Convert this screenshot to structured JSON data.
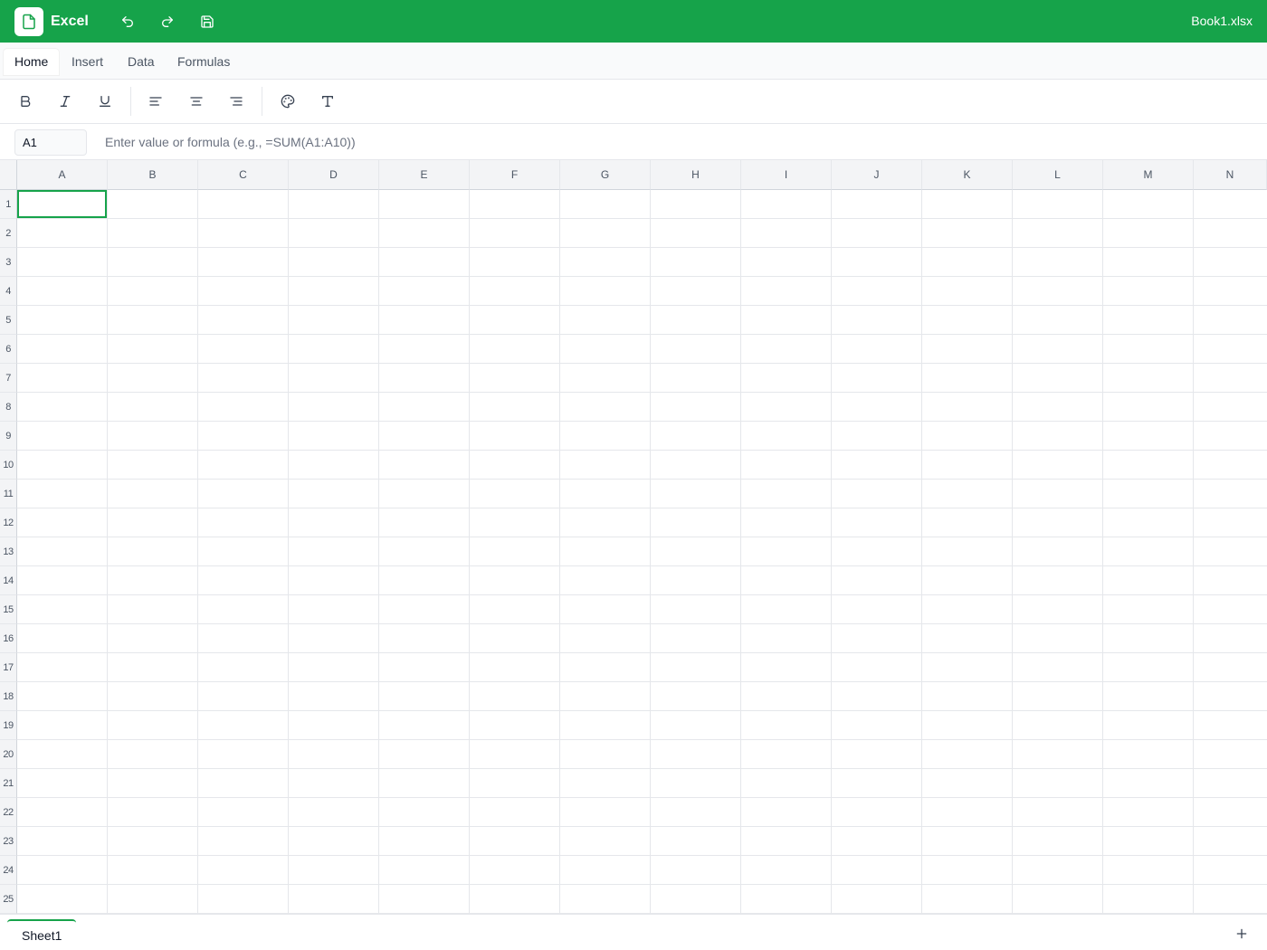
{
  "app": {
    "name": "Excel",
    "file_name": "Book1.xlsx",
    "accent": "#16a34a"
  },
  "titlebar": {
    "icons": [
      "file-icon",
      "undo-icon",
      "redo-icon",
      "save-icon"
    ]
  },
  "ribbon": {
    "tabs": [
      {
        "label": "Home",
        "active": true
      },
      {
        "label": "Insert",
        "active": false
      },
      {
        "label": "Data",
        "active": false
      },
      {
        "label": "Formulas",
        "active": false
      }
    ]
  },
  "toolbar": {
    "tools": [
      "bold-icon",
      "italic-icon",
      "underline-icon",
      "align-left-icon",
      "align-center-icon",
      "align-right-icon",
      "palette-icon",
      "text-icon"
    ]
  },
  "formula_bar": {
    "cell_ref": "A1",
    "value": "",
    "placeholder": "Enter value or formula (e.g., =SUM(A1:A10))"
  },
  "grid": {
    "columns": [
      "A",
      "B",
      "C",
      "D",
      "E",
      "F",
      "G",
      "H",
      "I",
      "J",
      "K",
      "L",
      "M",
      "N"
    ],
    "rows": [
      "1",
      "2",
      "3",
      "4",
      "5",
      "6",
      "7",
      "8",
      "9",
      "10",
      "11",
      "12",
      "13",
      "14",
      "15",
      "16",
      "17",
      "18",
      "19",
      "20",
      "21",
      "22",
      "23",
      "24",
      "25"
    ],
    "selected_cell": "A1"
  },
  "sheets": {
    "tabs": [
      {
        "label": "Sheet1",
        "active": true
      }
    ],
    "add_label": "+"
  }
}
